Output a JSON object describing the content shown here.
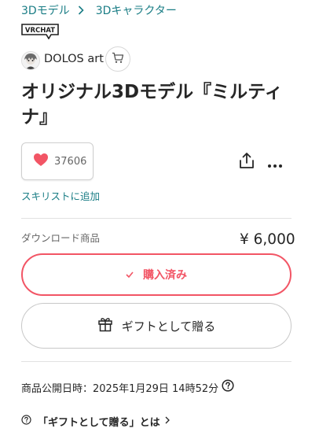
{
  "breadcrumb": {
    "items": [
      "3Dモデル",
      "3Dキャラクター"
    ]
  },
  "badge": {
    "label": "VRCHAT"
  },
  "shop": {
    "name": "DOLOS art"
  },
  "product": {
    "title": "オリジナル3Dモデル『ミルティナ』",
    "like_count": "37606",
    "wishlist_label": "スキリストに追加",
    "variant_label": "ダウンロード商品",
    "price": "¥ 6,000",
    "purchased_label": "購入済み",
    "gift_label": "ギフトとして贈る",
    "published_label": "商品公開日時：2025年1月29日 14時52分",
    "gift_help_label": "「ギフトとして贈る」とは"
  },
  "colors": {
    "accent_red": "#f25565",
    "link_teal": "#1a7d85",
    "heart": "#f25565"
  },
  "icons": {
    "breadcrumb_separator": "chevron-right-icon",
    "cart": "cart-icon",
    "heart": "heart-icon",
    "share": "share-icon",
    "more": "more-icon",
    "check": "check-icon",
    "gift": "gift-icon",
    "help": "question-circle-icon"
  }
}
